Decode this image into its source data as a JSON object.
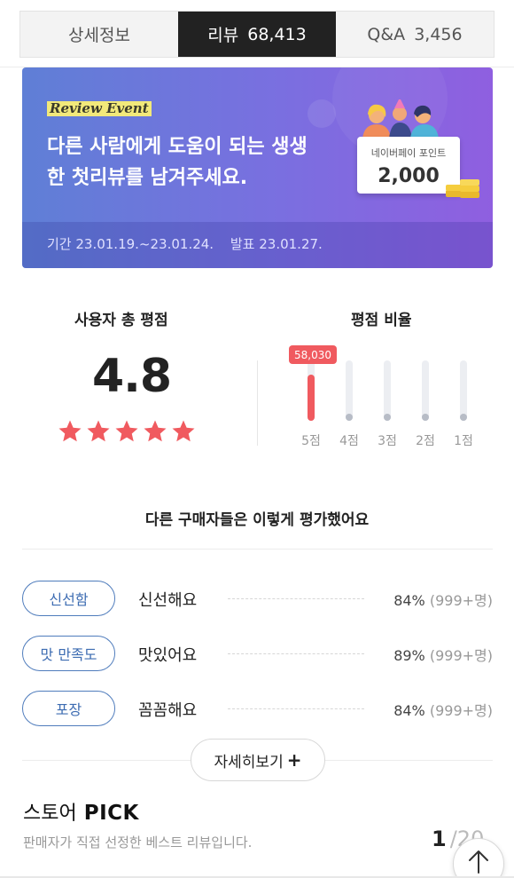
{
  "tabs": [
    {
      "label": "상세정보",
      "count": ""
    },
    {
      "label": "리뷰",
      "count": "68,413"
    },
    {
      "label": "Q&A",
      "count": "3,456"
    }
  ],
  "banner": {
    "event_tag": "Review Event",
    "headline_line1": "다른 사람에게 도움이 되는 생생",
    "headline_line2": "한 첫리뷰를 남겨주세요.",
    "card_label": "네이버페이 포인트",
    "card_points": "2,000",
    "period": "기간 23.01.19.~23.01.24.",
    "announce": "발표 23.01.27.",
    "colors": {
      "gradient_start": "#5f7fd6",
      "gradient_end": "#8f5fe0",
      "tag_bg": "#f2e97a"
    }
  },
  "rating": {
    "total_title": "사용자 총 평점",
    "average": "4.8",
    "stars_filled": 5,
    "ratio_title": "평점 비율",
    "top_count": "58,030",
    "bars": [
      {
        "label": "5점",
        "ratio": 0.85
      },
      {
        "label": "4점",
        "ratio": 0
      },
      {
        "label": "3점",
        "ratio": 0
      },
      {
        "label": "2점",
        "ratio": 0
      },
      {
        "label": "1점",
        "ratio": 0
      }
    ],
    "accent_color": "#f05a5f"
  },
  "evaluation": {
    "title": "다른 구매자들은 이렇게 평가했어요",
    "items": [
      {
        "tag": "신선함",
        "answer": "신선해요",
        "percent": "84%",
        "count": "(999+명)"
      },
      {
        "tag": "맛 만족도",
        "answer": "맛있어요",
        "percent": "89%",
        "count": "(999+명)"
      },
      {
        "tag": "포장",
        "answer": "꼼꼼해요",
        "percent": "84%",
        "count": "(999+명)"
      }
    ],
    "more_label": "자세히보기",
    "more_icon": "plus-icon"
  },
  "store_pick": {
    "title": "스토어",
    "title_bold": "PICK",
    "subtitle": "판매자가 직접 선정한 베스트 리뷰입니다.",
    "page_current": "1",
    "page_separator": "/",
    "page_total": "20"
  },
  "scroll_top_icon": "arrow-up-icon"
}
